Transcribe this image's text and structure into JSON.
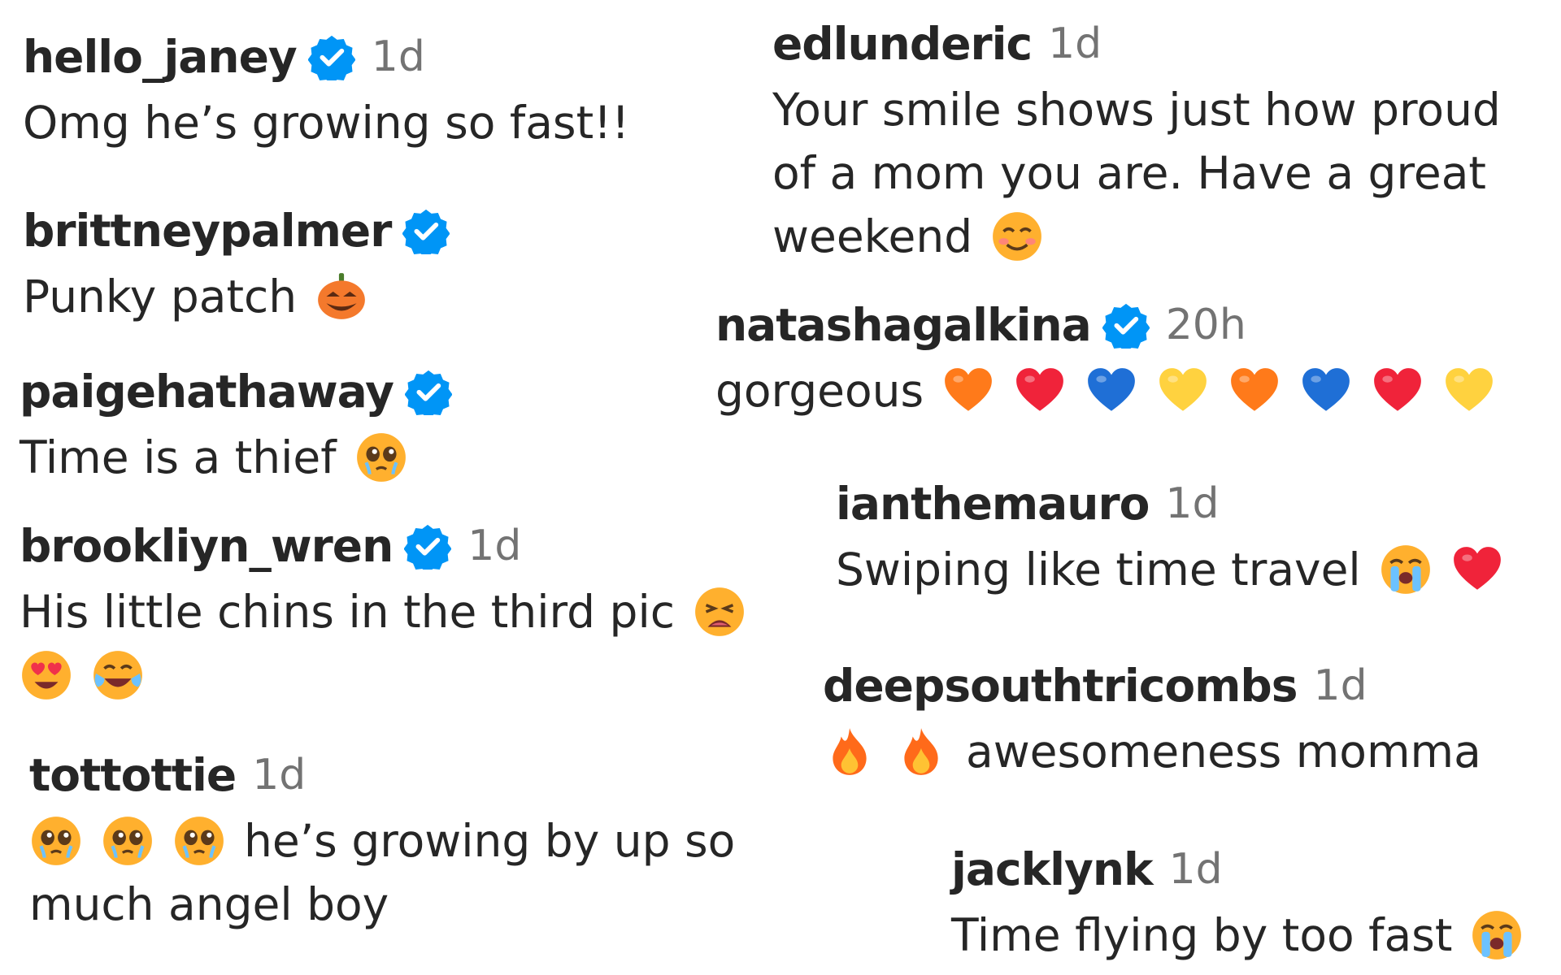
{
  "colors": {
    "text": "#262626",
    "time": "#737373",
    "verified": "#0095f6"
  },
  "comments": [
    {
      "id": "c1",
      "username": "hello_janey",
      "verified": true,
      "time": "1d",
      "lines": [
        {
          "text": "Omg he’s growing so fast!!",
          "emojis": []
        }
      ]
    },
    {
      "id": "c2",
      "username": "brittneypalmer",
      "verified": true,
      "time": "",
      "lines": [
        {
          "text": "Punky patch",
          "emojis": [
            "jack-o-lantern-emoji"
          ]
        }
      ]
    },
    {
      "id": "c3",
      "username": "paigehathaway",
      "verified": true,
      "time": "",
      "lines": [
        {
          "text": "Time is a thief",
          "emojis": [
            "pleading-tears-emoji"
          ]
        }
      ]
    },
    {
      "id": "c4",
      "username": "brookliyn_wren",
      "verified": true,
      "time": "1d",
      "lines": [
        {
          "text": "His little chins in the third pic",
          "emojis": [
            "weary-face-emoji"
          ]
        },
        {
          "text": "",
          "emojis": [
            "heart-eyes-emoji",
            "tears-of-joy-emoji"
          ]
        }
      ]
    },
    {
      "id": "c5",
      "username": "tottottie",
      "verified": false,
      "time": "1d",
      "lines": [
        {
          "text": "he’s growing by up so",
          "emojis_before": [
            "pleading-tears-emoji",
            "pleading-tears-emoji",
            "pleading-tears-emoji"
          ],
          "emojis": []
        },
        {
          "text": "much angel boy",
          "emojis": []
        }
      ]
    },
    {
      "id": "c6",
      "username": "edlunderic",
      "verified": false,
      "time": "1d",
      "lines": [
        {
          "text": "Your smile shows just how proud",
          "emojis": []
        },
        {
          "text": "of a mom you are. Have a great",
          "emojis": []
        },
        {
          "text": "weekend",
          "emojis": [
            "smiling-blush-emoji"
          ]
        }
      ]
    },
    {
      "id": "c7",
      "username": "natashagalkina",
      "verified": true,
      "time": "20h",
      "lines": [
        {
          "text": "gorgeous",
          "emojis": [
            "orange-heart-emoji",
            "red-heart-emoji",
            "blue-heart-emoji",
            "yellow-heart-emoji",
            "orange-heart-emoji",
            "blue-heart-emoji",
            "red-heart-emoji",
            "yellow-heart-emoji"
          ]
        }
      ]
    },
    {
      "id": "c8",
      "username": "ianthemauro",
      "verified": false,
      "time": "1d",
      "lines": [
        {
          "text": "Swiping like time travel",
          "emojis": [
            "loudly-crying-emoji",
            "red-heart-emoji"
          ]
        }
      ]
    },
    {
      "id": "c9",
      "username": "deepsouthtricombs",
      "verified": false,
      "time": "1d",
      "lines": [
        {
          "text": "awesomeness momma",
          "emojis_before": [
            "fire-emoji",
            "fire-emoji"
          ],
          "emojis": []
        }
      ]
    },
    {
      "id": "c10",
      "username": "jacklynk",
      "verified": false,
      "time": "1d",
      "lines": [
        {
          "text": "Time flying by too fast",
          "emojis": [
            "loudly-crying-emoji"
          ]
        }
      ]
    }
  ]
}
